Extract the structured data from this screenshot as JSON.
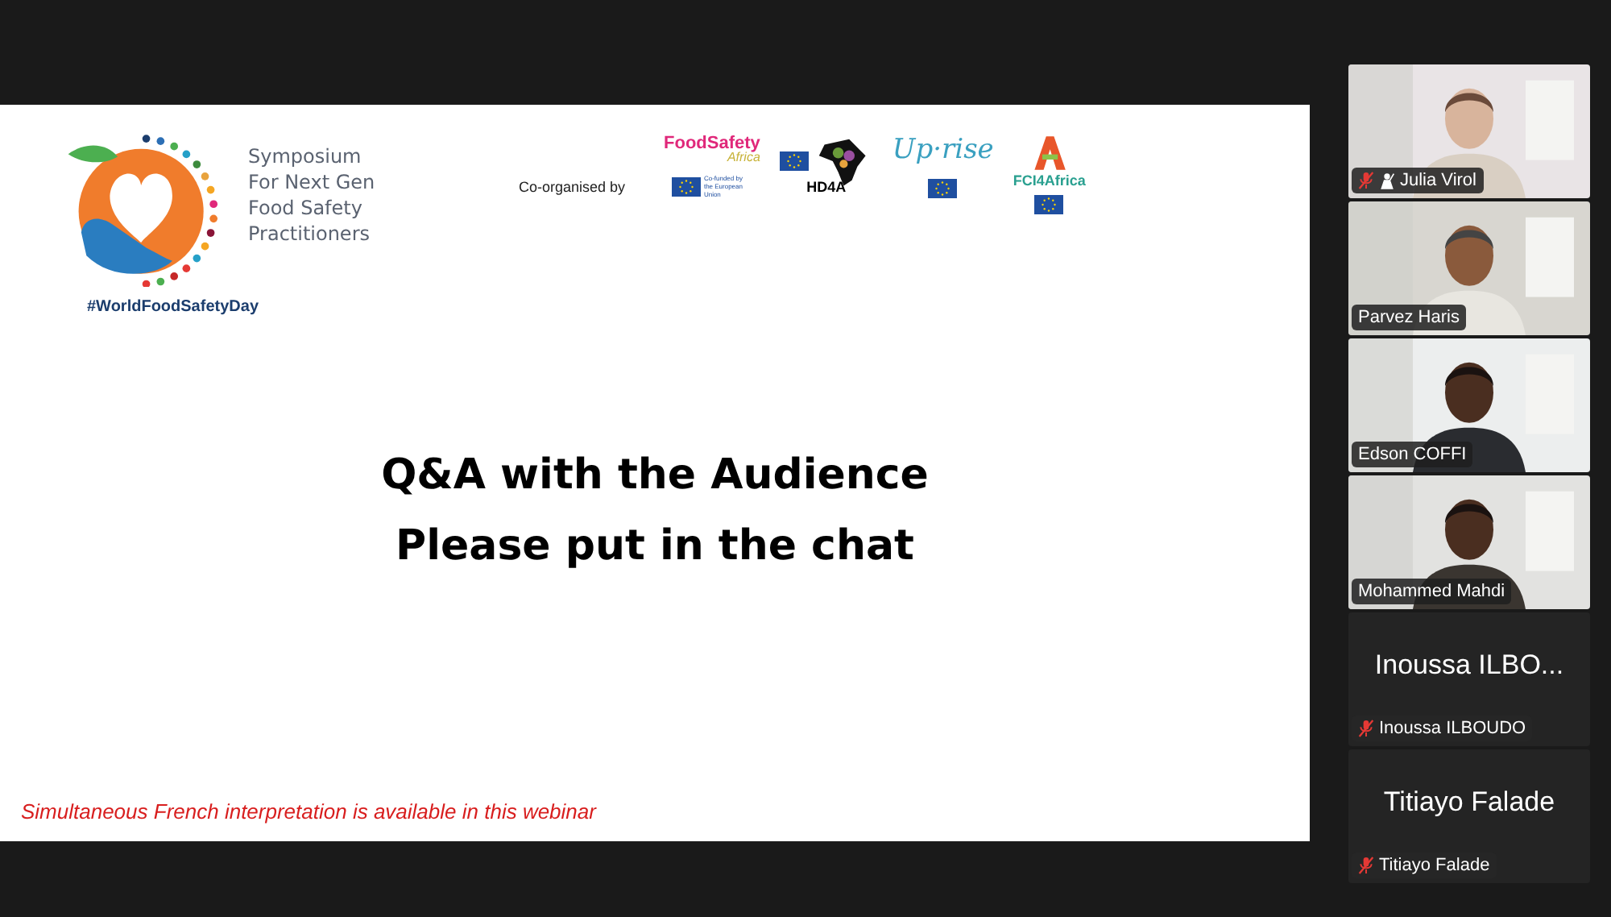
{
  "slide": {
    "event_title_lines": [
      "Symposium",
      "For Next Gen",
      "Food Safety",
      "Practitioners"
    ],
    "hashtag": "#WorldFoodSafetyDay",
    "co_organised_label": "Co-organised by",
    "partners": [
      {
        "kind": "foodsafety",
        "name": "FoodSafety",
        "sub": "Africa",
        "eu_note": "Co-funded by the European Union"
      },
      {
        "kind": "hd4a",
        "name": "HD4A"
      },
      {
        "kind": "uprise",
        "name": "Up·rise"
      },
      {
        "kind": "fci",
        "name": "FCI4Africa"
      }
    ],
    "headline_lines": [
      "Q&A with the Audience",
      "Please put in the chat"
    ],
    "footer_note": "Simultaneous French interpretation is available in this webinar"
  },
  "participants": [
    {
      "kind": "video",
      "name": "Julia Virol",
      "muted": true,
      "hand_raised": true
    },
    {
      "kind": "video",
      "name": "Parvez Haris",
      "muted": false,
      "hand_raised": false
    },
    {
      "kind": "video",
      "name": "Edson COFFI",
      "muted": false,
      "hand_raised": false
    },
    {
      "kind": "video",
      "name": "Mohammed Mahdi",
      "muted": false,
      "hand_raised": false
    },
    {
      "kind": "avatar",
      "display": "Inoussa ILBO...",
      "name": "Inoussa ILBOUDO",
      "muted": true,
      "hand_raised": false
    },
    {
      "kind": "avatar",
      "display": "Titiayo Falade",
      "name": "Titiayo Falade",
      "muted": true,
      "hand_raised": false
    }
  ]
}
